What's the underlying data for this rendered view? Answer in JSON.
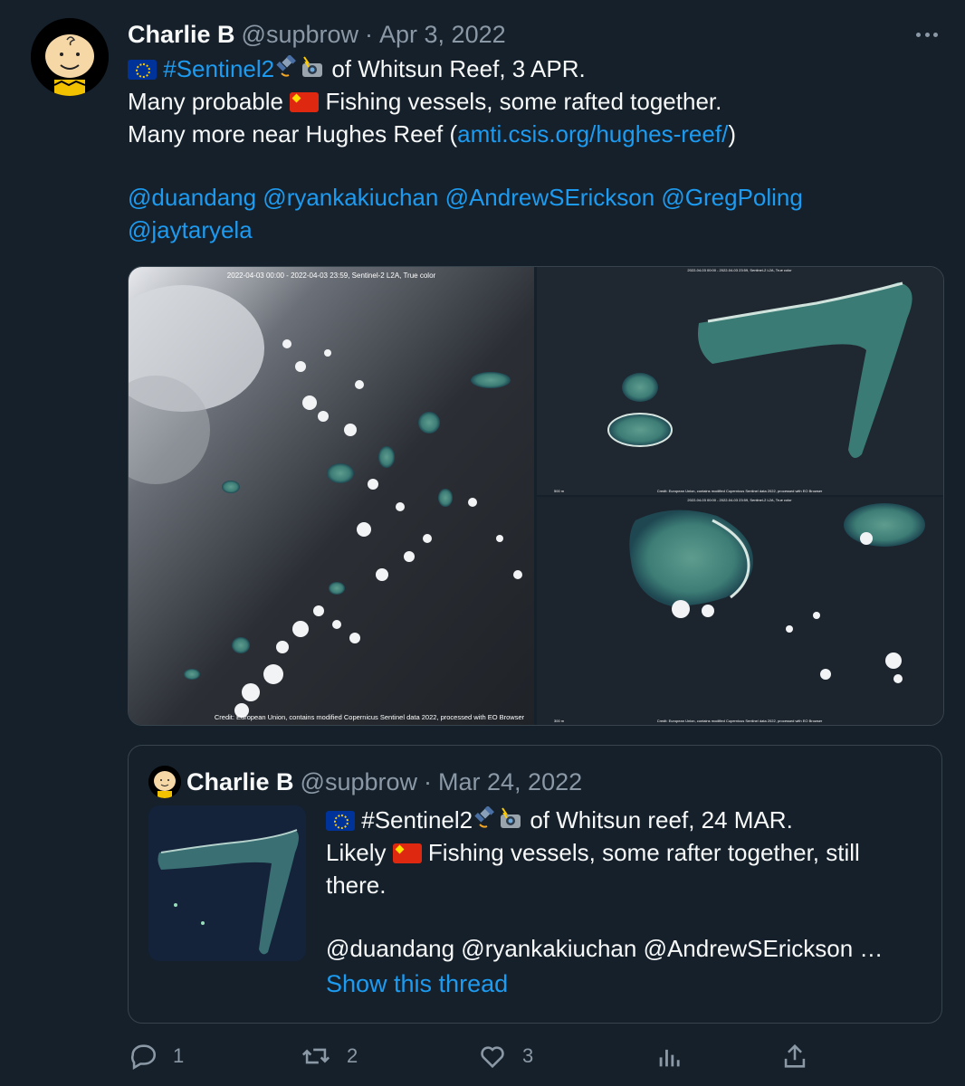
{
  "tweet": {
    "author_name": "Charlie B",
    "handle": "@supbrow",
    "separator": "·",
    "date": "Apr 3, 2022",
    "line1_hashtag": "#Sentinel2",
    "line1_rest": " of Whitsun Reef, 3 APR.",
    "line2_pre": "Many probable ",
    "line2_post": " Fishing vessels, some rafted together.",
    "line3_pre": "Many more near Hughes Reef (",
    "line3_link": "amti.csis.org/hughes-reef/",
    "line3_post": ")",
    "mentions_line1": "@duandang @ryankakiuchan @AndrewSErickson @GregPoling",
    "mentions_line2": "@jaytaryela"
  },
  "media": {
    "left_caption_top": "2022-04-03 00:00 - 2022-04-03 23:59, Sentinel-2 L2A, True color",
    "left_credit": "Credit: European Union, contains modified Copernicus Sentinel data 2022, processed with EO Browser",
    "right_top_caption": "2022-04-03 00:00 - 2022-04-03 23:59, Sentinel-2 L2A, True color",
    "right_top_credit": "Credit: European Union, contains modified Copernicus Sentinel data 2022, processed with EO Browser",
    "right_bottom_caption": "2022-04-03 00:00 - 2022-04-03 23:59, Sentinel-2 L2A, True color",
    "right_bottom_credit": "Credit: European Union, contains modified Copernicus Sentinel data 2022, processed with EO Browser",
    "scale_label_1": "500 m",
    "scale_label_2": "300 m"
  },
  "quote": {
    "author_name": "Charlie B",
    "handle": "@supbrow",
    "separator": "·",
    "date": "Mar 24, 2022",
    "line1_hashtag": "#Sentinel2",
    "line1_rest": " of Whitsun reef, 24 MAR.",
    "line2_pre": "Likely ",
    "line2_post": " Fishing vessels, some rafter together, still",
    "line3": "there.",
    "mentions": "@duandang @ryankakiuchan @AndrewSErickson  …",
    "show_thread": "Show this thread"
  },
  "actions": {
    "replies": "1",
    "retweets": "2",
    "likes": "3"
  },
  "icons": {
    "reply": "reply-icon",
    "retweet": "retweet-icon",
    "like": "heart-icon",
    "analytics": "analytics-icon",
    "share": "share-icon",
    "more": "more-icon"
  },
  "colors": {
    "background": "#15202b",
    "link": "#1d9bf0",
    "secondary_text": "#8b98a5",
    "border": "#38444d"
  }
}
